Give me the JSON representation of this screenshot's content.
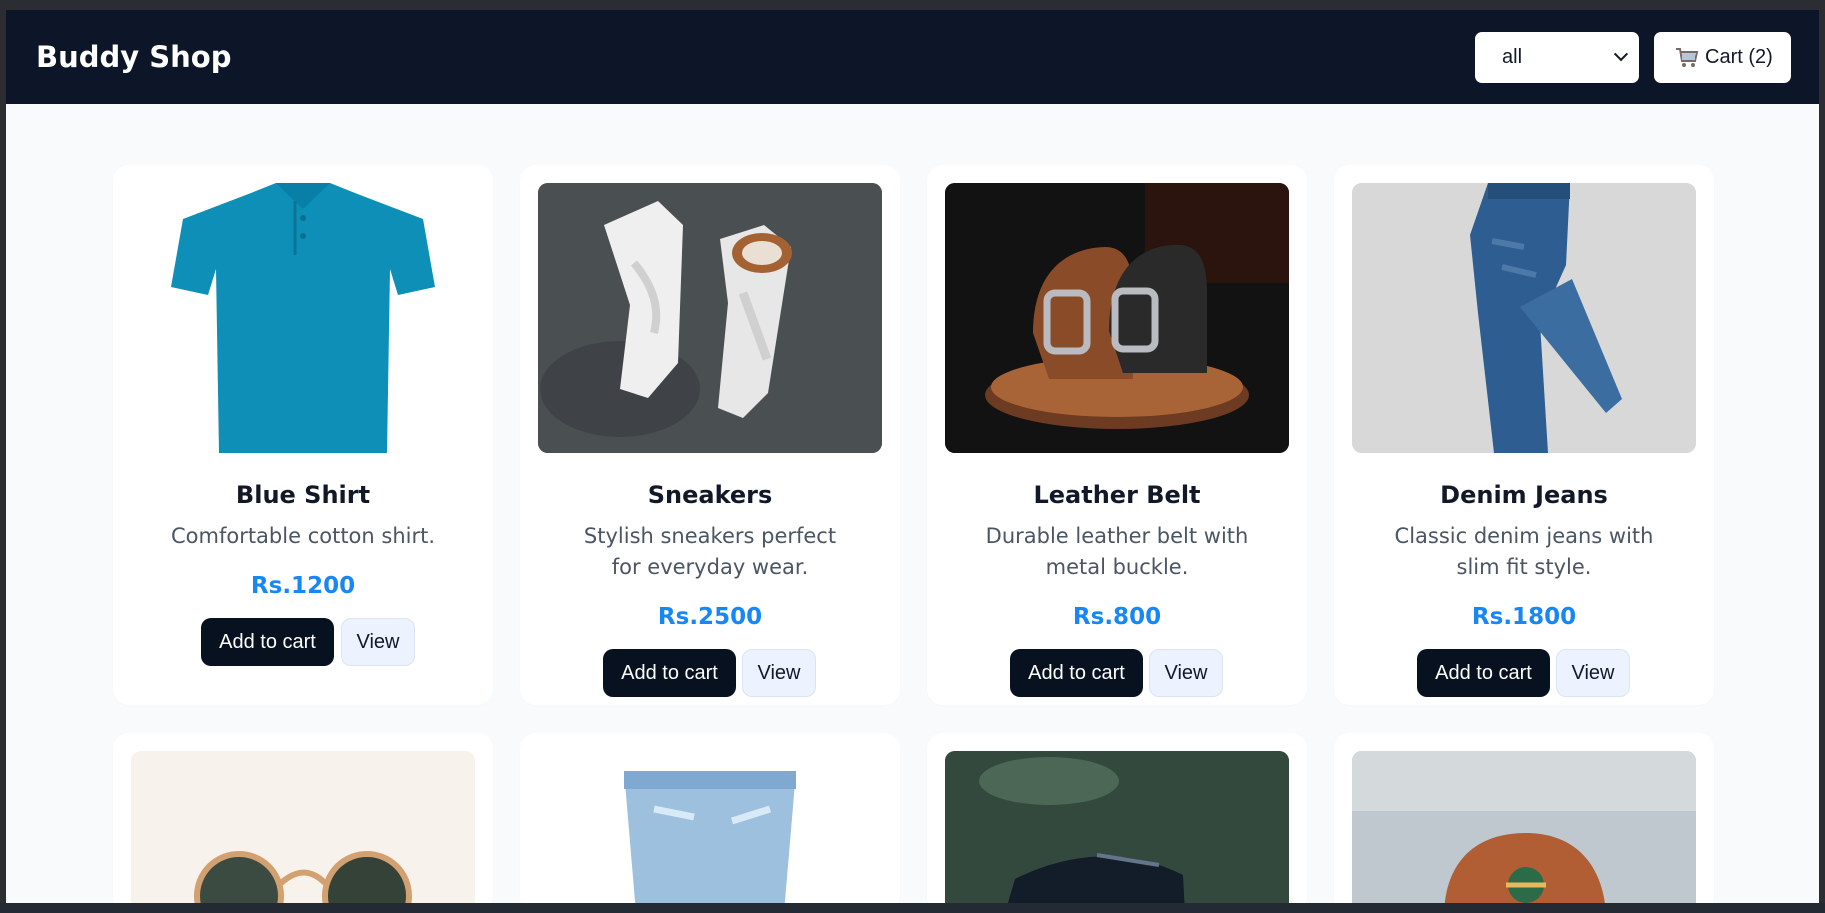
{
  "header": {
    "brand": "Buddy Shop",
    "filter_value": "all",
    "cart_label": "Cart (2)",
    "cart_icon": "cart-icon"
  },
  "products": [
    {
      "name": "Blue Shirt",
      "description": "Comfortable cotton shirt.",
      "price": "Rs.1200",
      "add_label": "Add to cart",
      "view_label": "View"
    },
    {
      "name": "Sneakers",
      "description": "Stylish sneakers perfect for everyday wear.",
      "price": "Rs.2500",
      "add_label": "Add to cart",
      "view_label": "View"
    },
    {
      "name": "Leather Belt",
      "description": "Durable leather belt with metal buckle.",
      "price": "Rs.800",
      "add_label": "Add to cart",
      "view_label": "View"
    },
    {
      "name": "Denim Jeans",
      "description": "Classic denim jeans with slim fit style.",
      "price": "Rs.1800",
      "add_label": "Add to cart",
      "view_label": "View"
    }
  ],
  "colors": {
    "header_bg": "#0d1628",
    "page_bg": "#f8fafc",
    "price": "#1787f6",
    "add_button": "#07111f"
  }
}
